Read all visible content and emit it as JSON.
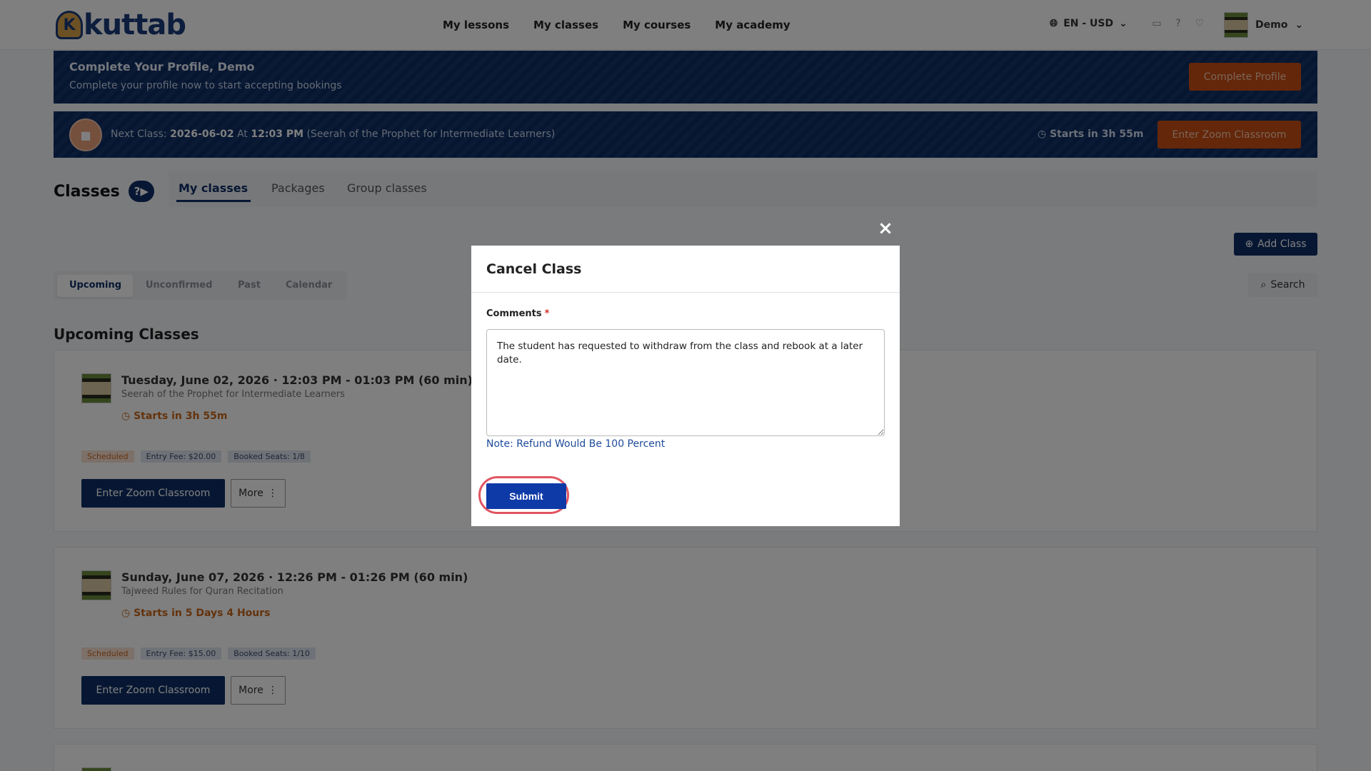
{
  "header": {
    "logo_letter": "K",
    "logo_text": "kuttab",
    "nav": [
      "My lessons",
      "My classes",
      "My courses",
      "My academy"
    ],
    "lang": "EN - USD",
    "user": "Demo"
  },
  "profile_banner": {
    "title": "Complete Your Profile, Demo",
    "subtitle": "Complete your profile now to start accepting bookings",
    "button": "Complete Profile"
  },
  "next_class_banner": {
    "prefix": "Next Class:",
    "date": "2026-06-02",
    "at": "At",
    "time": "12:03 PM",
    "course": "(Seerah of the Prophet for Intermediate Learners)",
    "starts": "Starts in 3h 55m",
    "button": "Enter Zoom Classroom"
  },
  "page": {
    "title": "Classes",
    "tabs": [
      "My classes",
      "Packages",
      "Group classes"
    ],
    "add_class": "Add Class",
    "subtabs": [
      "Upcoming",
      "Unconfirmed",
      "Past",
      "Calendar"
    ],
    "search": "Search",
    "section_title": "Upcoming Classes"
  },
  "classes": [
    {
      "title": "Tuesday, June 02, 2026 · 12:03 PM - 01:03 PM (60 min)",
      "course": "Seerah of the Prophet for Intermediate Learners",
      "starts": "Starts in 3h 55m",
      "status": "Scheduled",
      "fee": "Entry Fee: $20.00",
      "seats": "Booked Seats: 1/8",
      "zoom": "Enter Zoom Classroom",
      "more": "More"
    },
    {
      "title": "Sunday, June 07, 2026 · 12:26 PM - 01:26 PM (60 min)",
      "course": "Tajweed Rules for Quran Recitation",
      "starts": "Starts in 5 Days 4 Hours",
      "status": "Scheduled",
      "fee": "Entry Fee: $15.00",
      "seats": "Booked Seats: 1/10",
      "zoom": "Enter Zoom Classroom",
      "more": "More"
    }
  ],
  "modal": {
    "title": "Cancel Class",
    "comments_label": "Comments",
    "required_mark": "*",
    "comments_value": "The student has requested to withdraw from the class and rebook at a later date.",
    "note": "Note: Refund Would Be 100 Percent",
    "submit": "Submit",
    "close": "×"
  }
}
